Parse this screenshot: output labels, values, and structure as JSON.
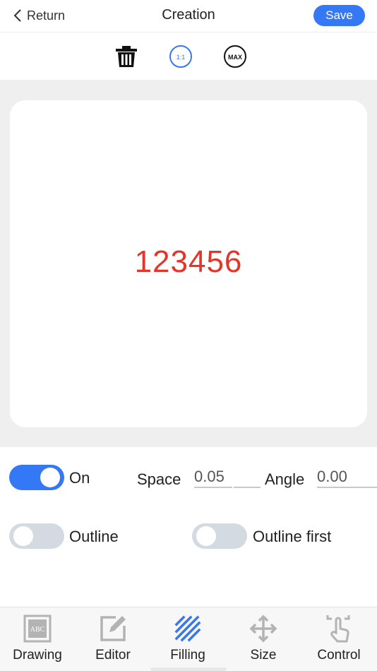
{
  "header": {
    "back_label": "Return",
    "title": "Creation",
    "save_label": "Save"
  },
  "toolbar": {
    "tools": [
      {
        "name": "trash-icon"
      },
      {
        "name": "ratio-1-1",
        "label": "1:1"
      },
      {
        "name": "max-size",
        "label": "MAX"
      }
    ]
  },
  "canvas": {
    "text": "123456",
    "text_color": "#e4352b"
  },
  "filling": {
    "fill_toggle": {
      "state": "on",
      "label": "On"
    },
    "space": {
      "label": "Space",
      "value": "0.05"
    },
    "angle": {
      "label": "Angle",
      "value": "0.00"
    },
    "outline_toggle": {
      "state": "off",
      "label": "Outline"
    },
    "outline_first_toggle": {
      "state": "off",
      "label": "Outline first"
    }
  },
  "tabs": [
    {
      "label": "Drawing",
      "icon": "abc-icon",
      "active": false
    },
    {
      "label": "Editor",
      "icon": "edit-icon",
      "active": false
    },
    {
      "label": "Filling",
      "icon": "hatch-icon",
      "active": true
    },
    {
      "label": "Size",
      "icon": "move-icon",
      "active": false
    },
    {
      "label": "Control",
      "icon": "hand-touch-icon",
      "active": false
    }
  ],
  "colors": {
    "accent": "#3478f6",
    "toggle_off": "#d3dae2",
    "canvas_bg": "#efefef"
  }
}
